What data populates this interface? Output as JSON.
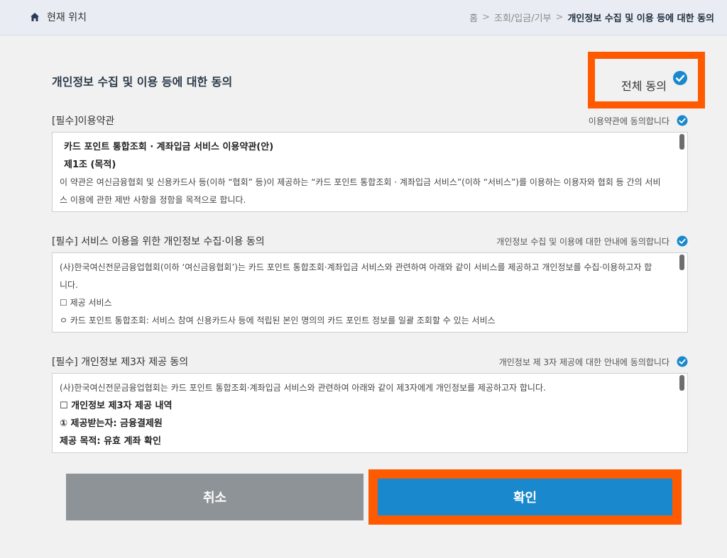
{
  "topbar": {
    "location_label": "현재 위치",
    "breadcrumb": [
      "홈",
      "조회/입금/기부",
      "개인정보 수집 및 이용 등에 대한 동의"
    ],
    "separator": ">"
  },
  "page_title": "개인정보 수집 및 이용 등에 대한 동의",
  "all_agree": {
    "label": "전체 동의",
    "checked": true
  },
  "sections": [
    {
      "title": "[필수]이용약관",
      "agree_label": "이용약관에 동의합니다",
      "lines": [
        {
          "text": "카드 포인트 통합조회 · 계좌입금 서비스 이용약관(안)",
          "bold": true
        },
        {
          "text": "제1조 (목적)",
          "bold": true
        },
        {
          "text": "이 약관은 여신금융협회 및 신용카드사 등(이하 “협회” 등)이 제공하는 “카드 포인트 통합조회 · 계좌입금 서비스”(이하 “서비스”)를 이용하는 이용자와 협회 등 간의 서비",
          "bold": false
        },
        {
          "text": "스 이용에 관한 제반 사항을 정함을 목적으로 합니다.",
          "bold": false
        }
      ]
    },
    {
      "title": "[필수] 서비스 이용을 위한 개인정보 수집·이용 동의",
      "agree_label": "개인정보 수집 및 이용에 대한 안내에 동의합니다",
      "lines": [
        {
          "text": "(사)한국여신전문금융업협회(이하 ‘여신금융협회’)는 카드 포인트 통합조회·계좌입금 서비스와 관련하여 아래와 같이 서비스를 제공하고 개인정보를 수집·이용하고자 합",
          "bold": false
        },
        {
          "text": "니다.",
          "bold": false
        },
        {
          "text": "☐ 제공 서비스",
          "bold": false
        },
        {
          "text": "ㅇ 카드 포인트 통합조회: 서비스 참여 신용카드사 등에 적립된 본인 명의의 카드 포인트 정보를 일괄 조회할 수 있는 서비스",
          "bold": false
        }
      ]
    },
    {
      "title": "[필수] 개인정보 제3자 제공 동의",
      "agree_label": "개인정보 제 3자 제공에 대한 안내에 동의합니다",
      "lines": [
        {
          "text": "(사)한국여신전문금융업협회는 카드 포인트 통합조회·계좌입금 서비스와 관련하여 아래와 같이 제3자에게 개인정보를 제공하고자 합니다.",
          "bold": false
        },
        {
          "text": "☐ 개인정보 제3자 제공 내역",
          "bold": true
        },
        {
          "text": "① 제공받는자: 금융결제원",
          "bold": true
        },
        {
          "text": "제공 목적: 유효 계좌 확인",
          "bold": true
        }
      ]
    }
  ],
  "buttons": {
    "cancel": "취소",
    "confirm": "확인"
  },
  "colors": {
    "accent": "#1a88cc",
    "highlight": "#ff5a00",
    "cancel": "#8d9397"
  },
  "icons": {
    "home": "home-icon",
    "check": "check-circle-icon"
  }
}
